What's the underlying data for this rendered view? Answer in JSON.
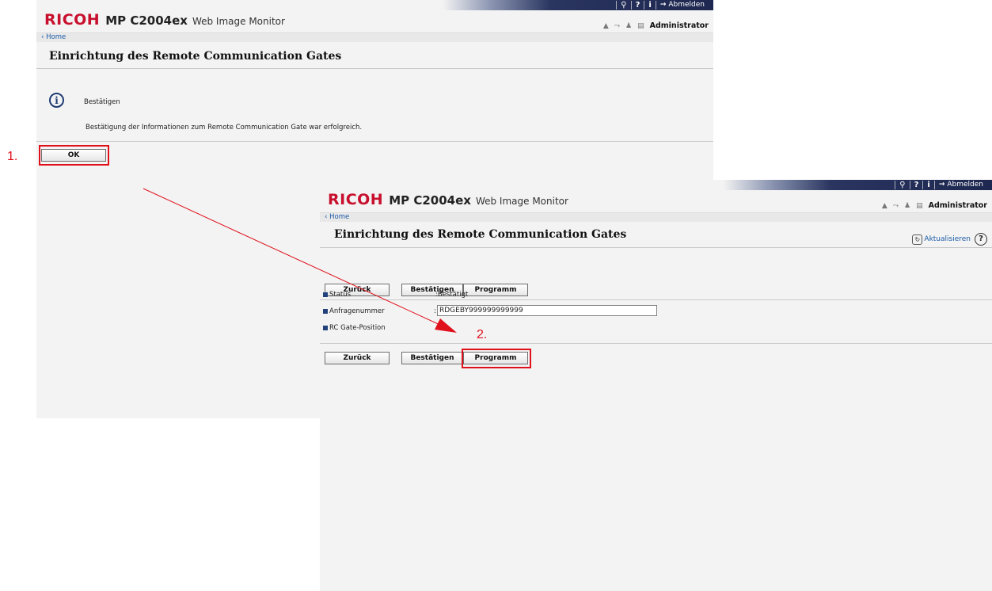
{
  "window": {
    "brand": "RICOH",
    "model": "MP C2004ex",
    "product": "Web Image Monitor",
    "logout_label": "Abmelden",
    "user_label": "Administrator",
    "home_link": "Home"
  },
  "dialog1": {
    "title": "Einrichtung des Remote Communication Gates",
    "message_heading": "Bestätigen",
    "message_text": "Bestätigung der Informationen zum Remote Communication Gate war erfolgreich.",
    "ok_label": "OK"
  },
  "dialog2": {
    "title": "Einrichtung des Remote Communication Gates",
    "refresh_label": "Aktualisieren",
    "buttons": {
      "back_label": "Zurück",
      "confirm_label": "Bestätigen",
      "program_label": "Programm"
    },
    "fields": [
      {
        "label": "Status",
        "value": ":Bestätigt"
      },
      {
        "label": "Anfragenummer",
        "value": "RDGEBY999999999999"
      },
      {
        "label": "RC Gate-Position",
        "value": ":"
      }
    ]
  },
  "annotations": {
    "step1": "1.",
    "step2": "2.",
    "highlight_color": "#e0101a"
  },
  "colors": {
    "brand_red": "#c8102e",
    "header_navy": "#1d274f",
    "panel_bg": "#f3f3f3"
  }
}
